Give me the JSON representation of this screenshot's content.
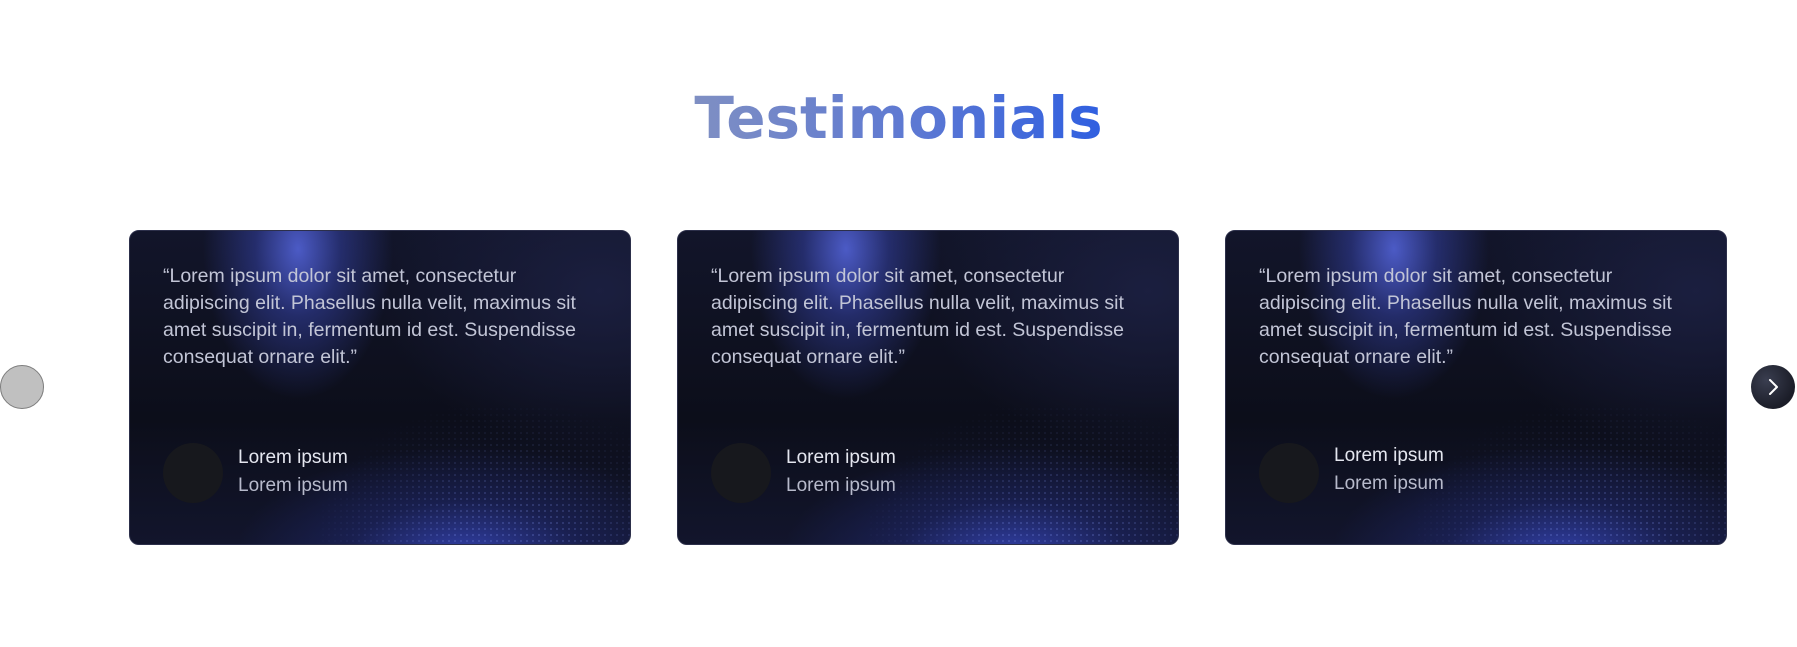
{
  "section": {
    "title": "Testimonials"
  },
  "testimonials": [
    {
      "quote": "“Lorem ipsum dolor sit amet, consectetur adipiscing elit. Phasellus nulla velit, maximus sit amet suscipit in, fermentum id est. Suspendisse consequat ornare elit.”",
      "name": "Lorem ipsum",
      "role": "Lorem ipsum"
    },
    {
      "quote": "“Lorem ipsum dolor sit amet, consectetur adipiscing elit. Phasellus nulla velit, maximus sit amet suscipit in, fermentum id est. Suspendisse consequat ornare elit.”",
      "name": "Lorem ipsum",
      "role": "Lorem ipsum"
    },
    {
      "quote": "“Lorem ipsum dolor sit amet, consectetur adipiscing elit. Phasellus nulla velit, maximus sit amet suscipit in, fermentum id est. Suspendisse consequat ornare elit.”",
      "name": "Lorem ipsum",
      "role": "Lorem ipsum"
    }
  ],
  "carousel": {
    "prev_icon": "circle-placeholder-icon",
    "next_icon": "chevron-right-icon"
  },
  "colors": {
    "title_gradient_start": "#7f8fc3",
    "title_gradient_end": "#2f5fe0",
    "card_background": "#0f1120",
    "card_glow": "#5667e1",
    "quote_text": "#c2c5d6",
    "name_text": "#e4e6ef",
    "avatar": "#17181d",
    "next_button": "#1b1d28",
    "prev_button": "#c0c0c0"
  }
}
